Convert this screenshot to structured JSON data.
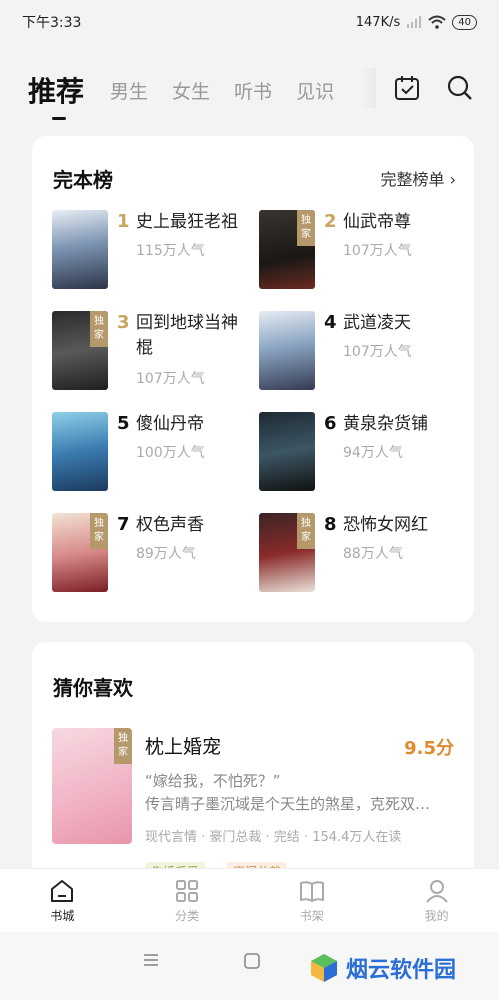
{
  "status": {
    "time": "下午3:33",
    "speed": "147K/s",
    "battery": "40"
  },
  "nav": {
    "tabs": [
      "推荐",
      "男生",
      "女生",
      "听书",
      "见识"
    ]
  },
  "ranking": {
    "title": "完本榜",
    "more": "完整榜单 ›",
    "exclusive_label": "独家",
    "books": [
      {
        "rank": "1",
        "name": "史上最狂老祖",
        "popularity": "115万人气",
        "exclusive": false
      },
      {
        "rank": "2",
        "name": "仙武帝尊",
        "popularity": "107万人气",
        "exclusive": true
      },
      {
        "rank": "3",
        "name": "回到地球当神棍",
        "popularity": "107万人气",
        "exclusive": true
      },
      {
        "rank": "4",
        "name": "武道凌天",
        "popularity": "107万人气",
        "exclusive": false
      },
      {
        "rank": "5",
        "name": "傻仙丹帝",
        "popularity": "100万人气",
        "exclusive": false
      },
      {
        "rank": "6",
        "name": "黄泉杂货铺",
        "popularity": "94万人气",
        "exclusive": false
      },
      {
        "rank": "7",
        "name": "权色声香",
        "popularity": "89万人气",
        "exclusive": true
      },
      {
        "rank": "8",
        "name": "恐怖女网红",
        "popularity": "88万人气",
        "exclusive": true
      }
    ]
  },
  "guess": {
    "title": "猜你喜欢",
    "book": {
      "name": "枕上婚宠",
      "score": "9.5分",
      "exclusive_label": "独家",
      "quote": "“嫁给我，不怕死？”",
      "desc": "传言晴子墨沉域是个天生的煞星，克死双…",
      "meta": "现代言情 · 豪门总裁 · 完结 · 154.4万人在读",
      "tags": [
        "先婚后爱",
        "豪门总裁"
      ]
    }
  },
  "bottom_nav": [
    {
      "label": "书城",
      "active": true
    },
    {
      "label": "分类",
      "active": false
    },
    {
      "label": "书架",
      "active": false
    },
    {
      "label": "我的",
      "active": false
    }
  ],
  "watermark": {
    "text": "烟云软件园"
  },
  "colors": {
    "gold": "#c9a55c",
    "score": "#e08a2e",
    "exclusive": "#b5996b",
    "watermark": "#2a6fd6"
  }
}
